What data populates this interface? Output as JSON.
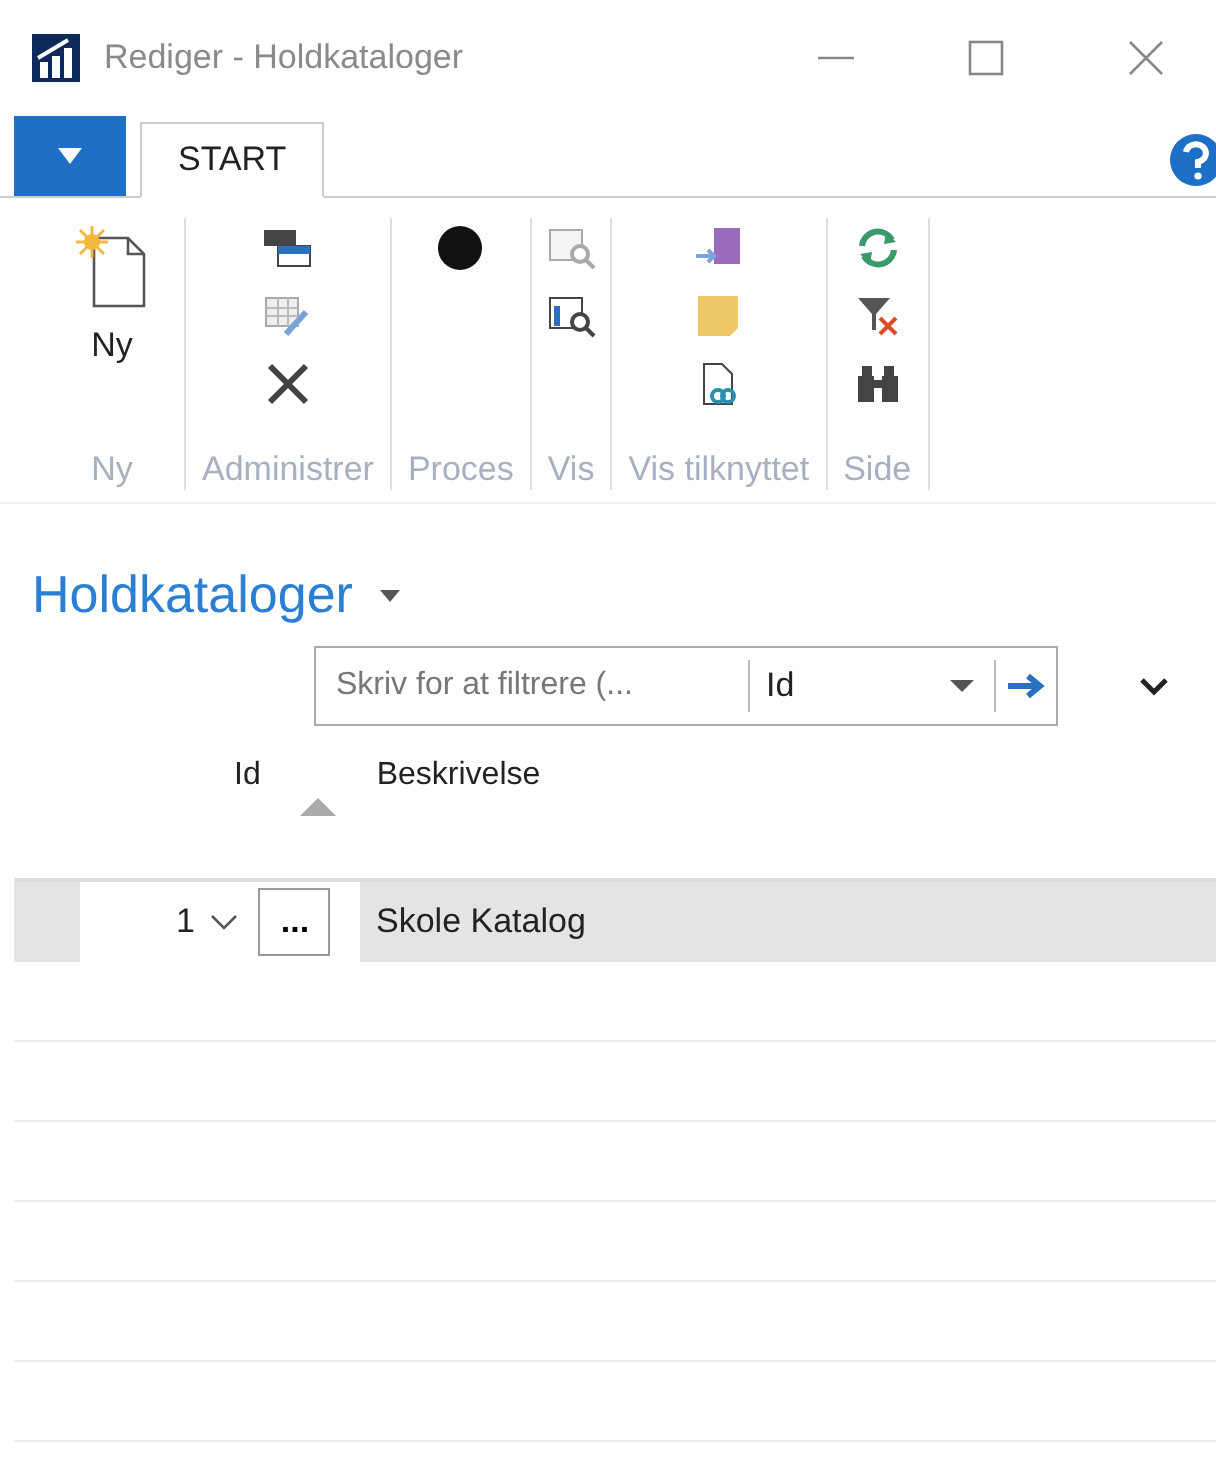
{
  "window": {
    "title": "Rediger - Holdkataloger"
  },
  "ribbon": {
    "tabs": [
      {
        "label": "START",
        "selected": true
      }
    ],
    "groups": [
      {
        "label": "Ny",
        "button_label": "Ny"
      },
      {
        "label": "Administrer"
      },
      {
        "label": "Proces"
      },
      {
        "label": "Vis"
      },
      {
        "label": "Vis tilknyttet"
      },
      {
        "label": "Side"
      }
    ]
  },
  "page": {
    "heading": "Holdkataloger"
  },
  "filter": {
    "placeholder": "Skriv for at filtrere (...",
    "field": "Id"
  },
  "table": {
    "columns": [
      {
        "label": "Id",
        "sorted": true
      },
      {
        "label": "Beskrivelse",
        "sorted": false
      }
    ],
    "rows": [
      {
        "id": "1",
        "actions": "...",
        "description": "Skole Katalog",
        "selected": true
      }
    ]
  }
}
